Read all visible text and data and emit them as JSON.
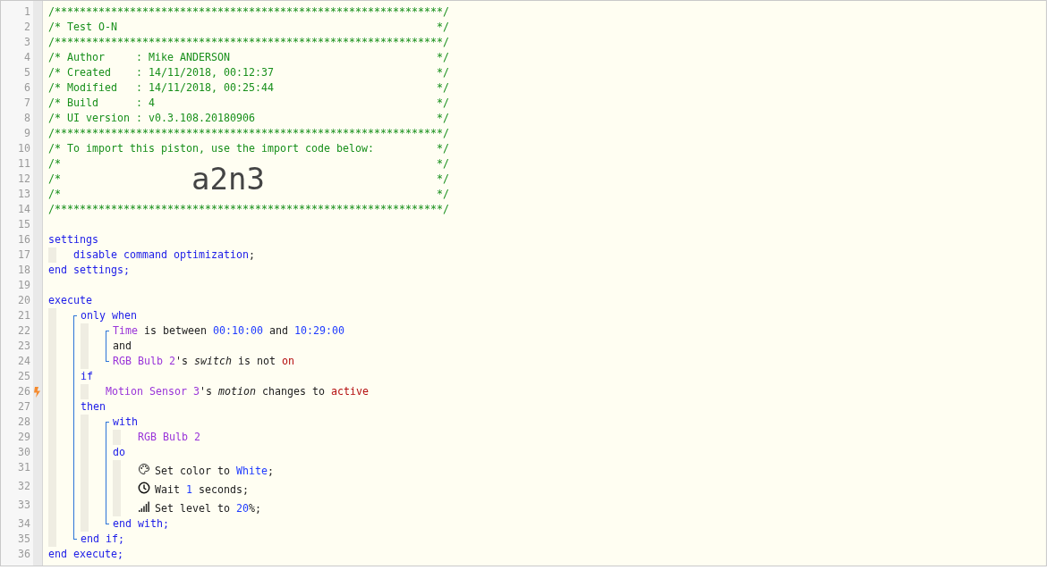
{
  "editor": {
    "lines": [
      {
        "number": "1",
        "kind": "line",
        "trigger": false,
        "tokens": [
          {
            "kind": "comment",
            "text": "/**************************************************************/"
          }
        ]
      },
      {
        "number": "2",
        "kind": "box",
        "trigger": false,
        "tokens": [
          {
            "kind": "comment",
            "text": "/* Test O-N"
          },
          {
            "kind": "comment",
            "text": "*/"
          }
        ]
      },
      {
        "number": "3",
        "kind": "line",
        "trigger": false,
        "tokens": [
          {
            "kind": "comment",
            "text": "/**************************************************************/"
          }
        ]
      },
      {
        "number": "4",
        "kind": "box",
        "trigger": false,
        "tokens": [
          {
            "kind": "comment",
            "text": "/* Author     : Mike ANDERSON"
          },
          {
            "kind": "comment",
            "text": "*/"
          }
        ]
      },
      {
        "number": "5",
        "kind": "box",
        "trigger": false,
        "tokens": [
          {
            "kind": "comment",
            "text": "/* Created    : 14/11/2018, 00:12:37"
          },
          {
            "kind": "comment",
            "text": "*/"
          }
        ]
      },
      {
        "number": "6",
        "kind": "box",
        "trigger": false,
        "tokens": [
          {
            "kind": "comment",
            "text": "/* Modified   : 14/11/2018, 00:25:44"
          },
          {
            "kind": "comment",
            "text": "*/"
          }
        ]
      },
      {
        "number": "7",
        "kind": "box",
        "trigger": false,
        "tokens": [
          {
            "kind": "comment",
            "text": "/* Build      : 4"
          },
          {
            "kind": "comment",
            "text": "*/"
          }
        ]
      },
      {
        "number": "8",
        "kind": "box",
        "trigger": false,
        "tokens": [
          {
            "kind": "comment",
            "text": "/* UI version : v0.3.108.20180906"
          },
          {
            "kind": "comment",
            "text": "*/"
          }
        ]
      },
      {
        "number": "9",
        "kind": "line",
        "trigger": false,
        "tokens": [
          {
            "kind": "comment",
            "text": "/**************************************************************/"
          }
        ]
      },
      {
        "number": "10",
        "kind": "box",
        "trigger": false,
        "tokens": [
          {
            "kind": "comment",
            "text": "/* To import this piston, use the import code below:"
          },
          {
            "kind": "comment",
            "text": "*/"
          }
        ]
      },
      {
        "number": "11",
        "kind": "box",
        "trigger": false,
        "tokens": [
          {
            "kind": "comment",
            "text": "/*"
          },
          {
            "kind": "comment",
            "text": "*/"
          }
        ]
      },
      {
        "number": "12",
        "kind": "import",
        "trigger": false,
        "tokens": [
          {
            "kind": "comment",
            "text": "/*"
          },
          {
            "kind": "code",
            "text": "a2n3"
          },
          {
            "kind": "comment",
            "text": "*/"
          }
        ]
      },
      {
        "number": "13",
        "kind": "box",
        "trigger": false,
        "tokens": [
          {
            "kind": "comment",
            "text": "/*"
          },
          {
            "kind": "comment",
            "text": "*/"
          }
        ]
      },
      {
        "number": "14",
        "kind": "line",
        "trigger": false,
        "tokens": [
          {
            "kind": "comment",
            "text": "/**************************************************************/"
          }
        ]
      },
      {
        "number": "15",
        "kind": "blank",
        "trigger": false
      },
      {
        "number": "16",
        "kind": "line",
        "trigger": false,
        "tokens": [
          {
            "kind": "keyword",
            "text": "settings"
          }
        ]
      },
      {
        "kind": "block",
        "bracket": false,
        "children": [
          {
            "number": "17",
            "kind": "line",
            "trigger": false,
            "tokens": [
              {
                "kind": "keyword",
                "text": "disable command optimization"
              },
              {
                "kind": "text",
                "text": ";"
              }
            ]
          }
        ]
      },
      {
        "number": "18",
        "kind": "line",
        "trigger": false,
        "tokens": [
          {
            "kind": "keyword",
            "text": "end settings;"
          }
        ]
      },
      {
        "number": "19",
        "kind": "blank",
        "trigger": false
      },
      {
        "number": "20",
        "kind": "line",
        "trigger": false,
        "tokens": [
          {
            "kind": "keyword",
            "text": "execute"
          }
        ]
      },
      {
        "kind": "block",
        "bracket": true,
        "children": [
          {
            "number": "21",
            "kind": "line",
            "trigger": false,
            "tokens": [
              {
                "kind": "keyword",
                "text": "only when"
              }
            ]
          },
          {
            "kind": "block",
            "bracket": true,
            "children": [
              {
                "number": "22",
                "kind": "line",
                "trigger": false,
                "tokens": [
                  {
                    "kind": "device",
                    "text": "Time"
                  },
                  {
                    "kind": "text",
                    "text": " is between "
                  },
                  {
                    "kind": "value",
                    "text": "00:10:00"
                  },
                  {
                    "kind": "text",
                    "text": " and "
                  },
                  {
                    "kind": "value",
                    "text": "10:29:00"
                  }
                ]
              },
              {
                "number": "23",
                "kind": "line",
                "trigger": false,
                "tokens": [
                  {
                    "kind": "text",
                    "text": "and"
                  }
                ]
              },
              {
                "number": "24",
                "kind": "line",
                "trigger": false,
                "tokens": [
                  {
                    "kind": "device",
                    "text": "RGB Bulb 2"
                  },
                  {
                    "kind": "text",
                    "text": "'s "
                  },
                  {
                    "kind": "attribute",
                    "text": "switch"
                  },
                  {
                    "kind": "text",
                    "text": " is not "
                  },
                  {
                    "kind": "state",
                    "text": "on"
                  }
                ]
              }
            ]
          },
          {
            "number": "25",
            "kind": "line",
            "trigger": false,
            "tokens": [
              {
                "kind": "keyword",
                "text": "if"
              }
            ]
          },
          {
            "kind": "block",
            "bracket": false,
            "children": [
              {
                "number": "26",
                "kind": "line",
                "trigger": true,
                "tokens": [
                  {
                    "kind": "device",
                    "text": "Motion Sensor 3"
                  },
                  {
                    "kind": "text",
                    "text": "'s "
                  },
                  {
                    "kind": "attribute",
                    "text": "motion"
                  },
                  {
                    "kind": "text",
                    "text": " changes to "
                  },
                  {
                    "kind": "state",
                    "text": "active"
                  }
                ]
              }
            ]
          },
          {
            "number": "27",
            "kind": "line",
            "trigger": false,
            "tokens": [
              {
                "kind": "keyword",
                "text": "then"
              }
            ]
          },
          {
            "kind": "block",
            "bracket": true,
            "children": [
              {
                "number": "28",
                "kind": "line",
                "trigger": false,
                "tokens": [
                  {
                    "kind": "keyword",
                    "text": "with"
                  }
                ]
              },
              {
                "kind": "block",
                "bracket": false,
                "children": [
                  {
                    "number": "29",
                    "kind": "line",
                    "trigger": false,
                    "tokens": [
                      {
                        "kind": "device",
                        "text": "RGB Bulb 2"
                      }
                    ]
                  }
                ]
              },
              {
                "number": "30",
                "kind": "line",
                "trigger": false,
                "tokens": [
                  {
                    "kind": "keyword",
                    "text": "do"
                  }
                ]
              },
              {
                "kind": "block",
                "bracket": false,
                "children": [
                  {
                    "number": "31",
                    "kind": "color",
                    "trigger": false,
                    "tokens": [
                      {
                        "kind": "text",
                        "text": "Set color to "
                      },
                      {
                        "kind": "value",
                        "text": "White"
                      },
                      {
                        "kind": "text",
                        "text": ";"
                      }
                    ]
                  },
                  {
                    "number": "32",
                    "kind": "wait",
                    "trigger": false,
                    "tokens": [
                      {
                        "kind": "text",
                        "text": "Wait "
                      },
                      {
                        "kind": "value",
                        "text": "1"
                      },
                      {
                        "kind": "text",
                        "text": " seconds;"
                      }
                    ]
                  },
                  {
                    "number": "33",
                    "kind": "level",
                    "trigger": false,
                    "tokens": [
                      {
                        "kind": "text",
                        "text": "Set level to "
                      },
                      {
                        "kind": "value",
                        "text": "20"
                      },
                      {
                        "kind": "text",
                        "text": "%;"
                      }
                    ]
                  }
                ]
              },
              {
                "number": "34",
                "kind": "line",
                "trigger": false,
                "tokens": [
                  {
                    "kind": "keyword",
                    "text": "end with;"
                  }
                ]
              }
            ]
          },
          {
            "number": "35",
            "kind": "line",
            "trigger": false,
            "tokens": [
              {
                "kind": "keyword",
                "text": "end if;"
              }
            ]
          }
        ]
      },
      {
        "number": "36",
        "kind": "line",
        "trigger": false,
        "tokens": [
          {
            "kind": "keyword",
            "text": "end execute;"
          }
        ]
      }
    ]
  }
}
